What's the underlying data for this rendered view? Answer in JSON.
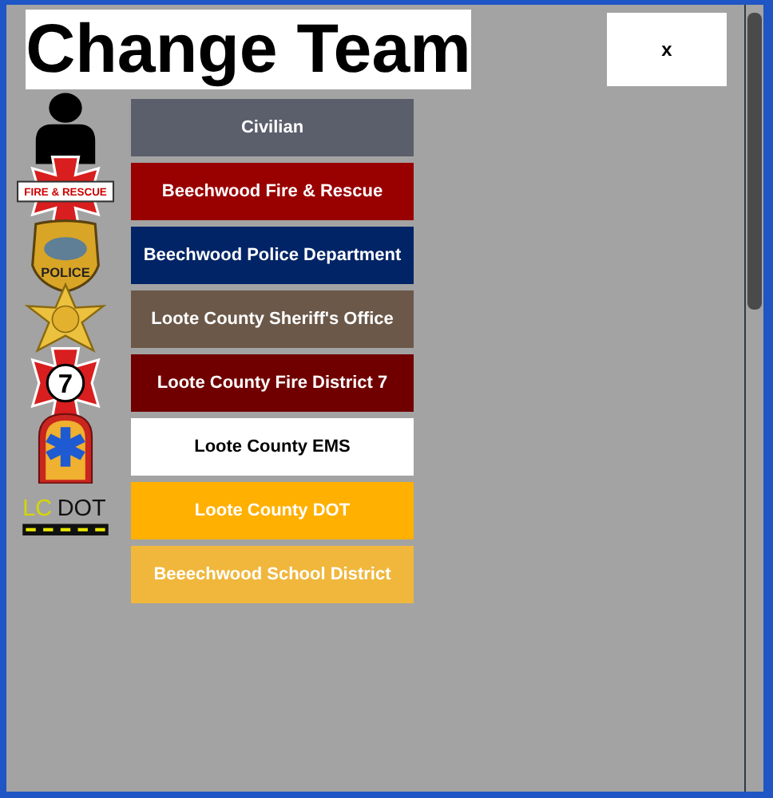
{
  "title": "Change Team",
  "close_button": "x",
  "teams": [
    {
      "label": "Civilian",
      "color": "#5b5e6b",
      "kind": "person"
    },
    {
      "label": "Beechwood Fire & Rescue",
      "color": "#990000",
      "kind": "fire",
      "badge_text": "FIRE & RESCUE"
    },
    {
      "label": "Beechwood Police Department",
      "color": "#002466",
      "kind": "police",
      "badge_text": "POLICE"
    },
    {
      "label": "Loote County Sheriff's Office",
      "color": "#6b5849",
      "kind": "star"
    },
    {
      "label": "Loote County Fire District 7",
      "color": "#700000",
      "kind": "fire7",
      "badge_text": "7"
    },
    {
      "label": "Loote County EMS",
      "color": "#ffffff",
      "kind": "ems"
    },
    {
      "label": "Loote County DOT",
      "color": "#ffb000",
      "kind": "dot",
      "badge_text": [
        "LC",
        "DOT"
      ]
    },
    {
      "label": "Beeechwood School District",
      "color": "#f0b73c",
      "kind": "plain"
    }
  ]
}
